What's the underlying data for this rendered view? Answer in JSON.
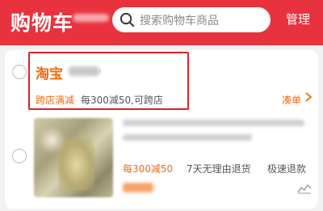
{
  "header": {
    "title": "购物车",
    "manage_label": "管理",
    "bg_color": "#e8333e"
  },
  "search": {
    "placeholder": "搜索购物车商品",
    "icon": "search-icon"
  },
  "shop": {
    "name": "淘宝",
    "promo_tag": "跨店满减",
    "promo_desc": "每300减50,可跨店",
    "coupon_label": "凑单"
  },
  "item": {
    "promo": "每300减50",
    "tags": [
      "7天无理由退货",
      "极速退款"
    ]
  },
  "colors": {
    "accent_orange": "#f26b0f",
    "highlight_red": "#e02020"
  }
}
